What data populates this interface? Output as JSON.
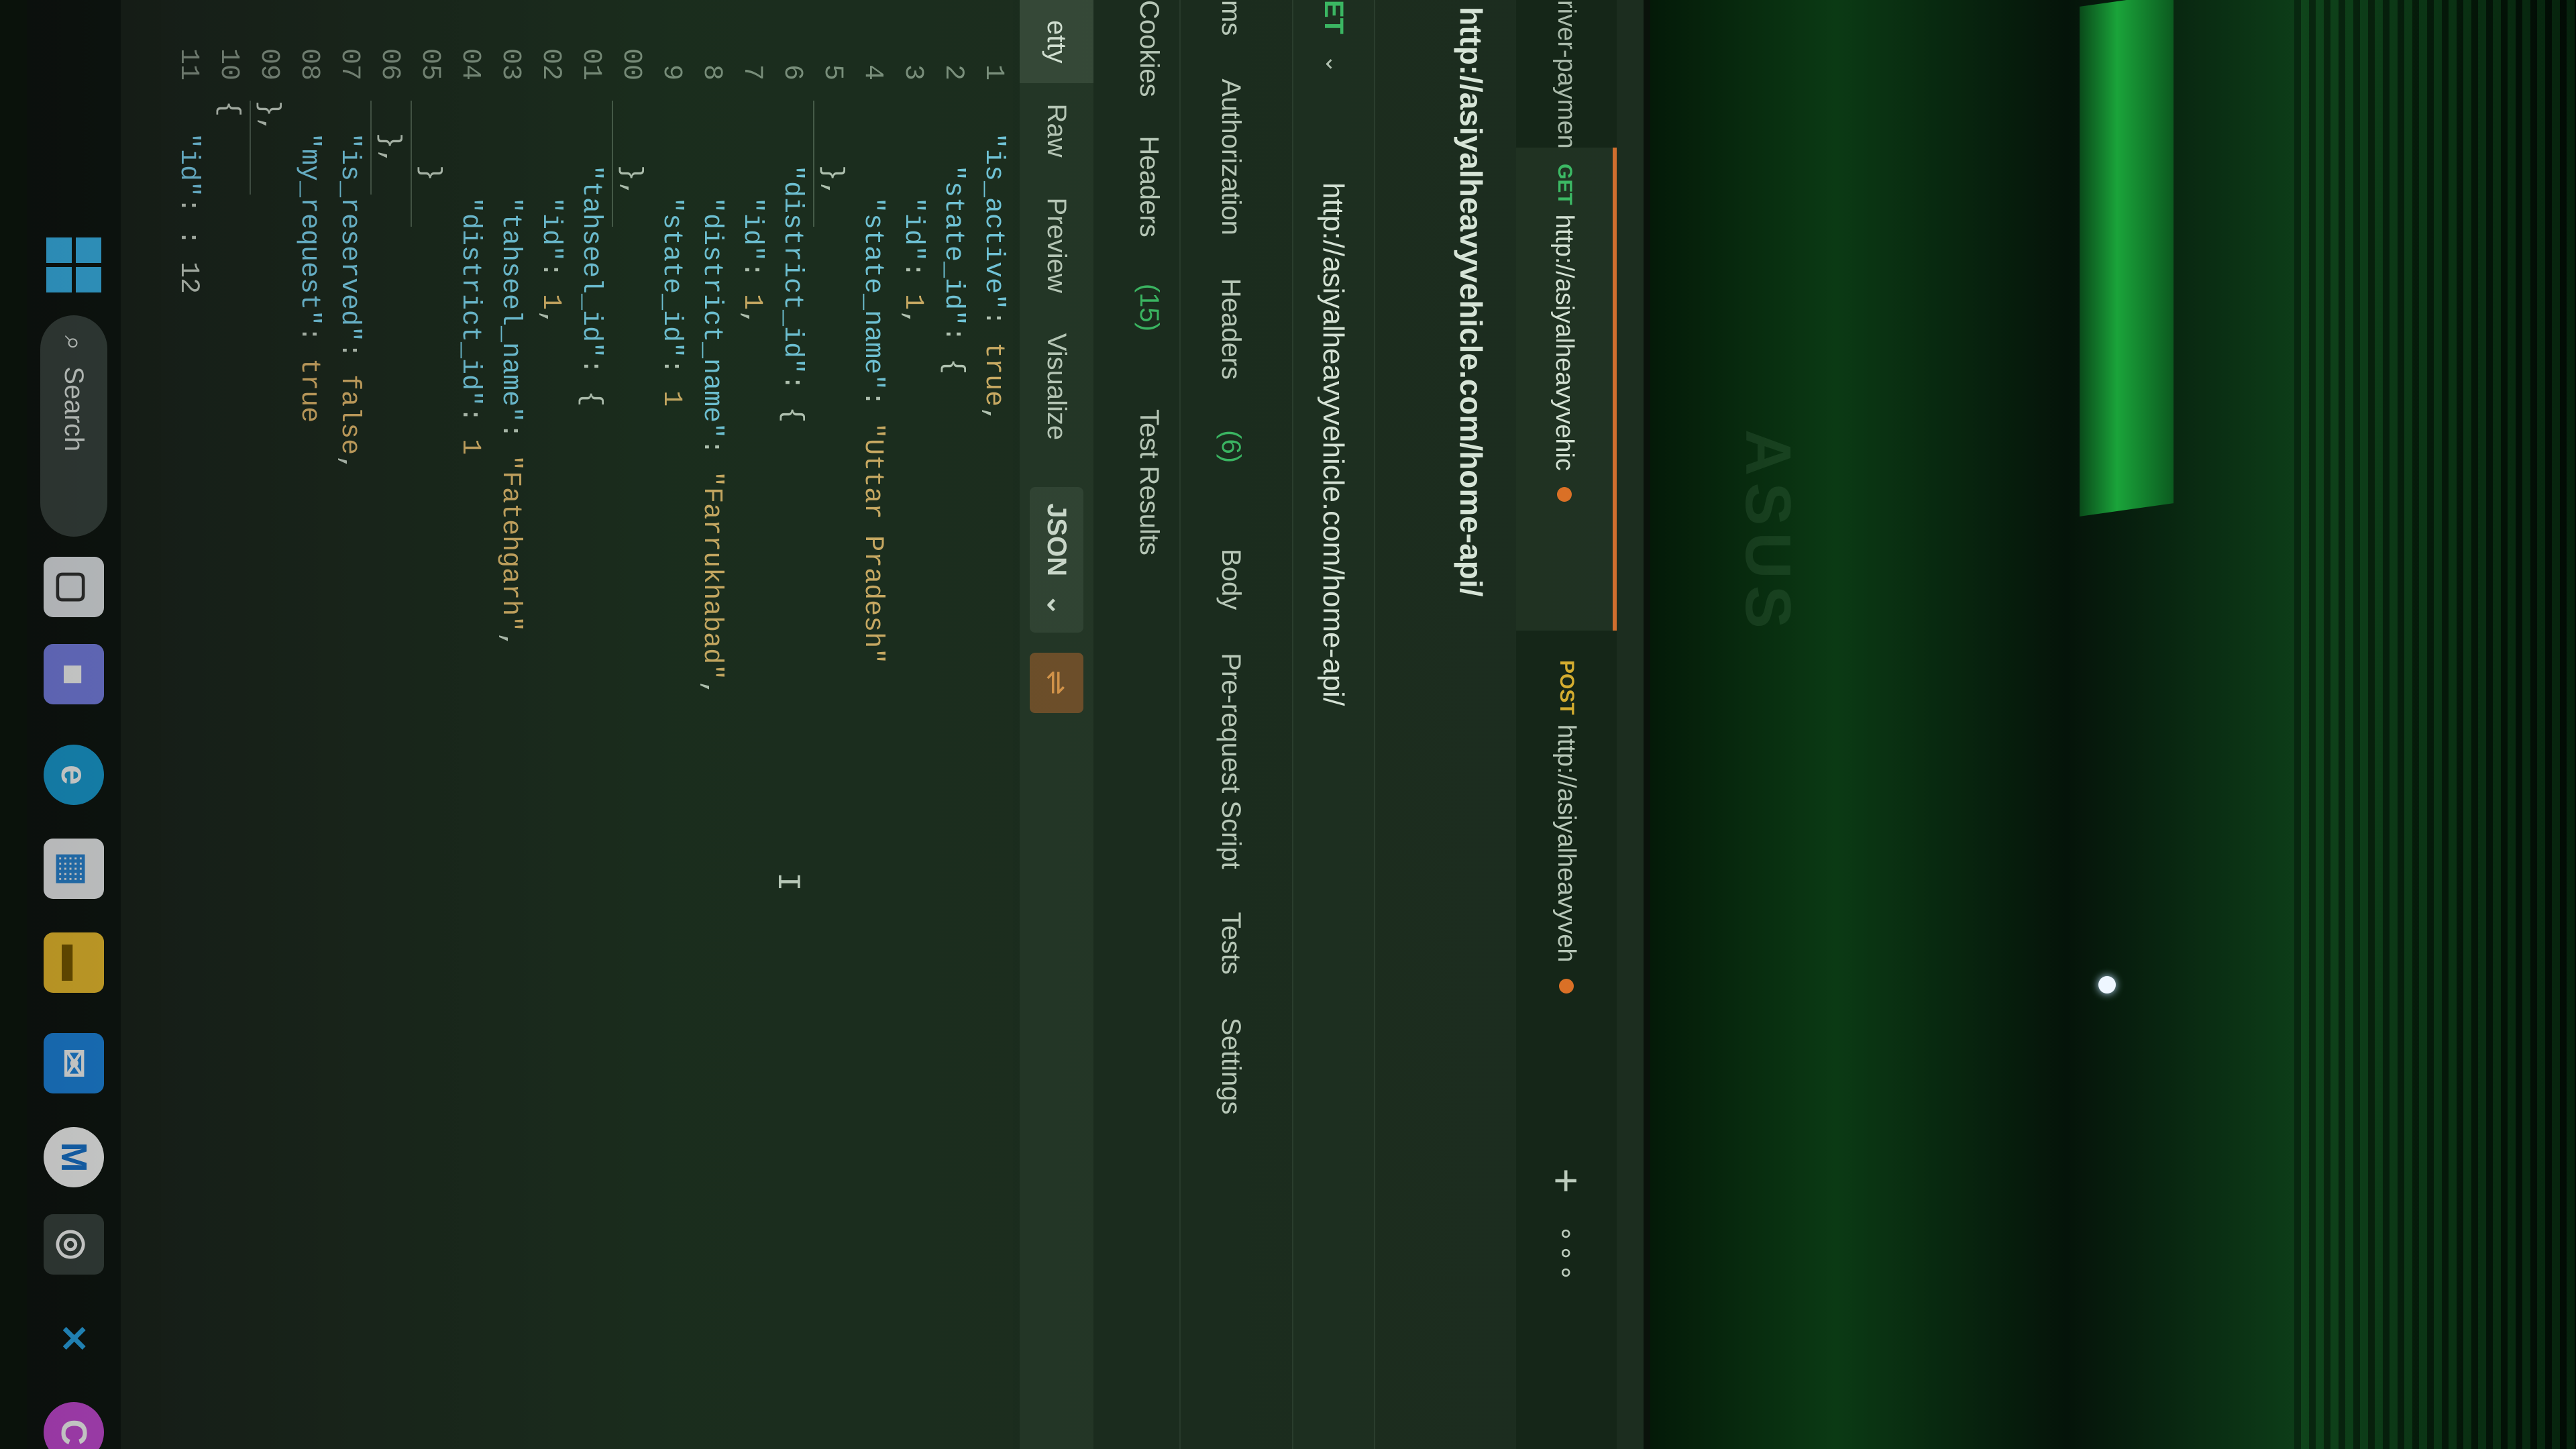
{
  "tabs": [
    {
      "method": "",
      "label": "river-paymenthandler/"
    },
    {
      "method": "GET",
      "label": "http://asiyalheavyvehic",
      "unsaved": true
    },
    {
      "method": "POST",
      "label": "http://asiyalheavyveh",
      "unsaved": true
    }
  ],
  "tab_actions": {
    "add": "+",
    "more": "∘∘∘"
  },
  "request": {
    "title": "http://asiyalheavyvehicle.com/home-api/",
    "method": "ET",
    "url": "http://asiyalheavyvehicle.com/home-api/"
  },
  "request_tabs": {
    "params": "ms",
    "authorization": "Authorization",
    "headers": "Headers",
    "headers_count": "(6)",
    "body": "Body",
    "prerequest": "Pre-request Script",
    "tests": "Tests",
    "settings": "Settings"
  },
  "response_tabs": {
    "cookies": "Cookies",
    "headers": "Headers",
    "headers_count": "(15)",
    "test_results": "Test Results"
  },
  "body_view": {
    "pretty": "etty",
    "raw": "Raw",
    "preview": "Preview",
    "visualize": "Visualize",
    "format": "JSON"
  },
  "code": {
    "line_numbers": [
      "1",
      "2",
      "3",
      "4",
      "5",
      "6",
      "7",
      "8",
      "9",
      "00",
      "01",
      "02",
      "03",
      "04",
      "05",
      "06",
      "07",
      "08",
      "09",
      "10",
      "11"
    ],
    "lines": [
      {
        "indent": 0,
        "key": "\"is_active\"",
        "value": "true",
        "tail": ","
      },
      {
        "indent": 1,
        "key": "\"state_id\"",
        "value": "",
        "tail": "{"
      },
      {
        "indent": 2,
        "key": "\"id\"",
        "value": "1",
        "tail": ","
      },
      {
        "indent": 2,
        "key": "\"state_name\"",
        "value": "\"Uttar Pradesh\"",
        "tail": ""
      },
      {
        "indent": 1,
        "key": "",
        "value": "",
        "tail": "},"
      },
      {
        "indent": 1,
        "key": "\"district_id\"",
        "value": "",
        "tail": "{"
      },
      {
        "indent": 2,
        "key": "\"id\"",
        "value": "1",
        "tail": ","
      },
      {
        "indent": 2,
        "key": "\"district_name\"",
        "value": "\"Farrukhabad\"",
        "tail": ","
      },
      {
        "indent": 2,
        "key": "\"state_id\"",
        "value": "1",
        "tail": ""
      },
      {
        "indent": 1,
        "key": "",
        "value": "",
        "tail": "},"
      },
      {
        "indent": 1,
        "key": "\"tahseel_id\"",
        "value": "",
        "tail": "{"
      },
      {
        "indent": 2,
        "key": "\"id\"",
        "value": "1",
        "tail": ","
      },
      {
        "indent": 2,
        "key": "\"tahseel_name\"",
        "value": "\"Fatehgarh\"",
        "tail": ","
      },
      {
        "indent": 2,
        "key": "\"district_id\"",
        "value": "1",
        "tail": ""
      },
      {
        "indent": 1,
        "key": "",
        "value": "",
        "tail": "}"
      },
      {
        "indent": 0,
        "key": "",
        "value": "",
        "tail": "},"
      },
      {
        "indent": 0,
        "key": "\"is_reserved\"",
        "value": "false",
        "tail": ","
      },
      {
        "indent": 0,
        "key": "\"my_request\"",
        "value": "true",
        "tail": ""
      },
      {
        "indent": -1,
        "key": "",
        "value": "",
        "tail": "},"
      },
      {
        "indent": -1,
        "key": "",
        "value": "",
        "tail": "{"
      },
      {
        "indent": 0,
        "key": "\"id\"",
        "value": "",
        "tail": ": 12"
      }
    ]
  },
  "taskbar": {
    "search_label": "Search",
    "apps": [
      "windows-start-icon",
      "search-icon",
      "files-icon",
      "teams-icon",
      "edge-icon",
      "store-icon",
      "folder-icon",
      "mail-icon",
      "meet-icon",
      "chrome-icon",
      "vscode-icon",
      "canva-icon"
    ]
  },
  "colors": {
    "accent": "#e36b2c",
    "get": "#3fbf6a",
    "post": "#e9b22f",
    "json_key": "#7fd3f5",
    "json_value": "#e8b66e"
  }
}
